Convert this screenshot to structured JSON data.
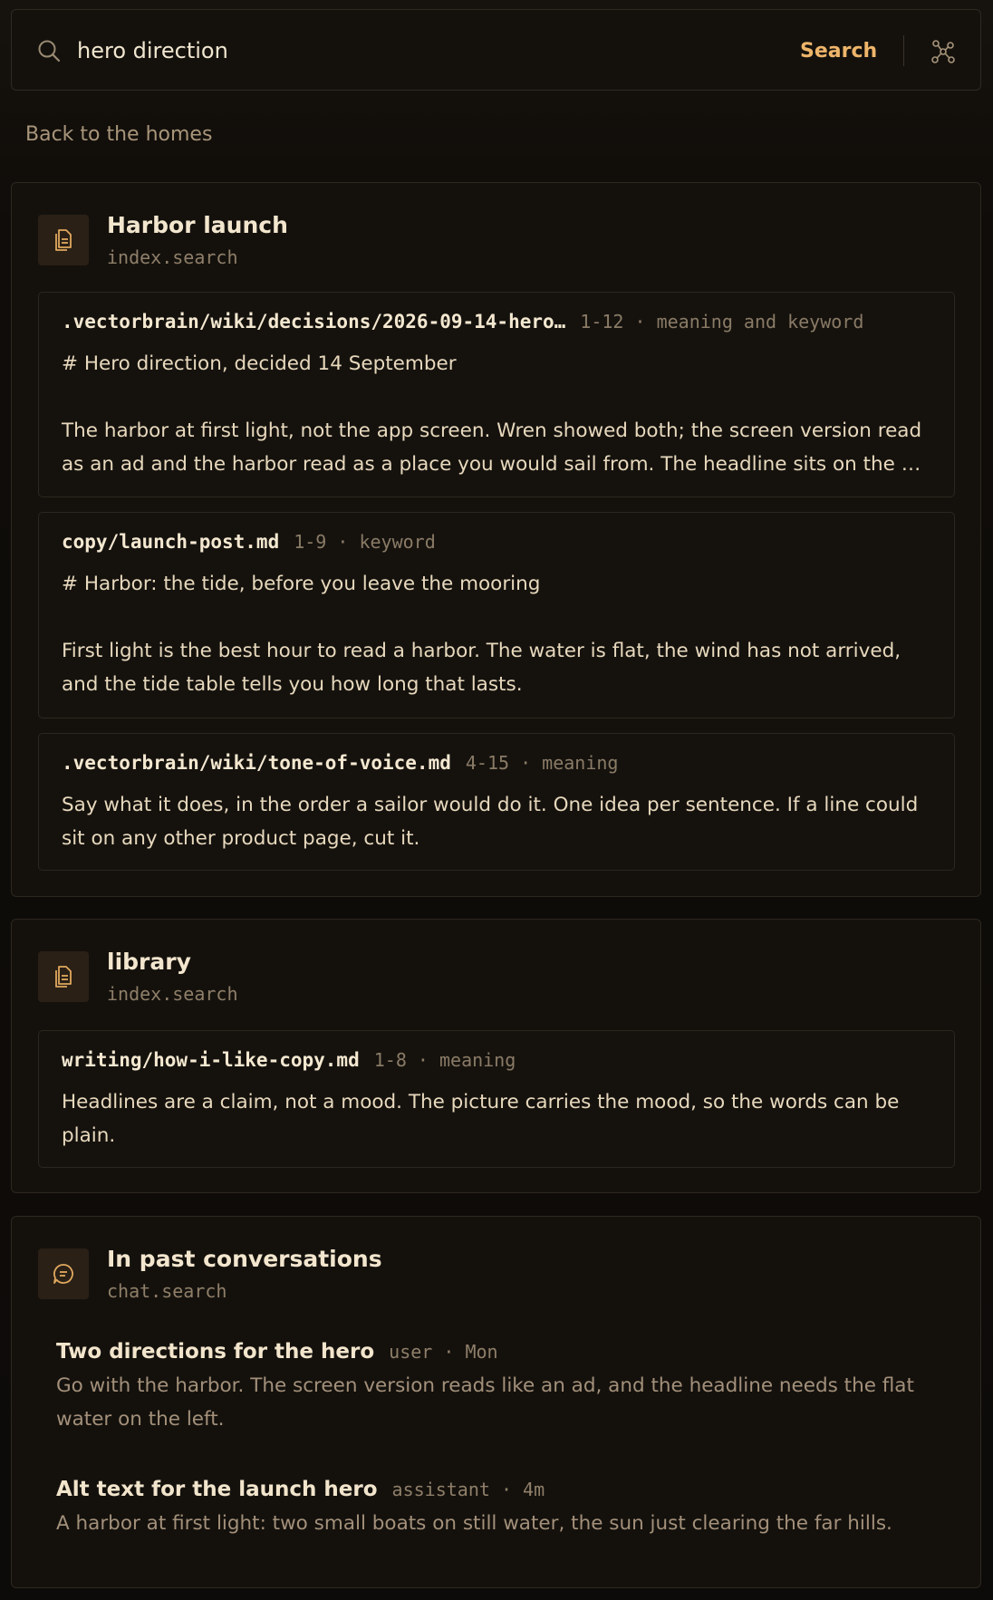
{
  "search": {
    "query": "hero direction",
    "placeholder": "",
    "button_label": "Search",
    "search_icon": "search-icon",
    "graph_icon": "graph-network-icon"
  },
  "back_link": "Back to the homes",
  "colors": {
    "accent": "#eeb56a",
    "background": "#0f0c09",
    "card": "#14110d",
    "text": "#efe1c7",
    "muted": "#8f7f69"
  },
  "groups": [
    {
      "icon": "document-icon",
      "title": "Harbor launch",
      "tool": "index.search",
      "results": [
        {
          "path": ".vectorbrain/wiki/decisions/2026-09-14-hero…",
          "meta": "1-12 · meaning and keyword",
          "heading": "# Hero direction, decided 14 September",
          "text": "The harbor at first light, not the app screen. Wren showed both; the screen version read as an ad and the harbor read as a place you would sail from. The headline sits on the …"
        },
        {
          "path": "copy/launch-post.md",
          "meta": "1-9 · keyword",
          "heading": "# Harbor: the tide, before you leave the mooring",
          "text": "First light is the best hour to read a harbor. The water is flat, the wind has not arrived, and the tide table tells you how long that lasts."
        },
        {
          "path": ".vectorbrain/wiki/tone-of-voice.md",
          "meta": "4-15 · meaning",
          "text": "Say what it does, in the order a sailor would do it. One idea per sentence. If a line could sit on any other product page, cut it."
        }
      ]
    },
    {
      "icon": "document-icon",
      "title": "library",
      "tool": "index.search",
      "results": [
        {
          "path": "writing/how-i-like-copy.md",
          "meta": "1-8 · meaning",
          "text": "Headlines are a claim, not a mood. The picture carries the mood, so the words can be plain."
        }
      ]
    },
    {
      "icon": "chat-bubble-icon",
      "title": "In past conversations",
      "tool": "chat.search",
      "conversations": [
        {
          "title": "Two directions for the hero",
          "meta": "user · Mon",
          "text": "Go with the harbor. The screen version reads like an ad, and the headline needs the flat water on the left."
        },
        {
          "title": "Alt text for the launch hero",
          "meta": "assistant · 4m",
          "text": "A harbor at first light: two small boats on still water, the sun just clearing the far hills."
        }
      ]
    }
  ]
}
